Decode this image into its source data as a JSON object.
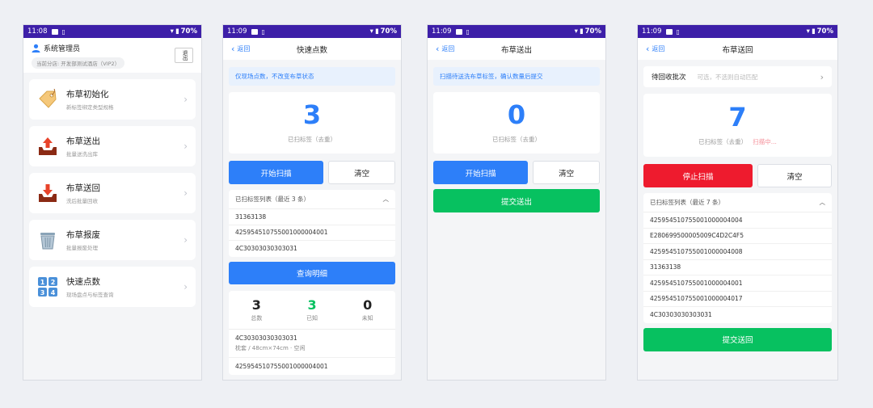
{
  "status_time_a": "11:08",
  "status_time_b": "11:09",
  "battery": "70%",
  "home": {
    "user": "系统管理员",
    "store": "当前分店: 开发部测试酒店（VIP2）",
    "logout": "退出",
    "items": [
      {
        "title": "布草初始化",
        "sub": "新标签绑定类型规格",
        "icon": "tag-icon"
      },
      {
        "title": "布草送出",
        "sub": "批量送洗出库",
        "icon": "outbox-icon"
      },
      {
        "title": "布草送回",
        "sub": "洗后批量回收",
        "icon": "inbox-icon"
      },
      {
        "title": "布草报废",
        "sub": "批量报废处理",
        "icon": "trash-icon"
      },
      {
        "title": "快速点数",
        "sub": "现场盘点与标签查询",
        "icon": "numbers-icon"
      }
    ]
  },
  "count": {
    "back": "返回",
    "title": "快速点数",
    "banner": "仅现场点数，不改变布草状态",
    "number": "3",
    "label": "已扫标签（去重）",
    "start": "开始扫描",
    "clear": "清空",
    "list_head": "已扫标签列表（最近 3 条）",
    "list": [
      "31363138",
      "425954510755001000004001",
      "4C30303030303031"
    ],
    "query": "查询明细",
    "stats": [
      {
        "v": "3",
        "k": "总数",
        "color": "#222"
      },
      {
        "v": "3",
        "k": "已知",
        "color": "#07c160"
      },
      {
        "v": "0",
        "k": "未知",
        "color": "#222"
      }
    ],
    "detail_code": "4C30303030303031",
    "detail_sub": "枕套 / 48cm×74cm · 空闲",
    "detail_code2": "425954510755001000004001"
  },
  "sendout": {
    "back": "返回",
    "title": "布草送出",
    "banner": "扫描待送洗布草标签，确认数量后提交",
    "number": "0",
    "label": "已扫标签（去重）",
    "start": "开始扫描",
    "clear": "清空",
    "submit": "提交送出"
  },
  "sendback": {
    "back": "返回",
    "title": "布草送回",
    "picker_label": "待回收批次",
    "picker_ph": "可选，不选则自动匹配",
    "number": "7",
    "label": "已扫标签（去重）",
    "scanning": "扫描中...",
    "stop": "停止扫描",
    "clear": "清空",
    "list_head": "已扫标签列表（最近 7 条）",
    "list": [
      "425954510755001000004004",
      "E280699500005009C4D2C4F5",
      "425954510755001000004008",
      "31363138",
      "425954510755001000004001",
      "425954510755001000004017",
      "4C30303030303031"
    ],
    "submit": "提交送回"
  }
}
